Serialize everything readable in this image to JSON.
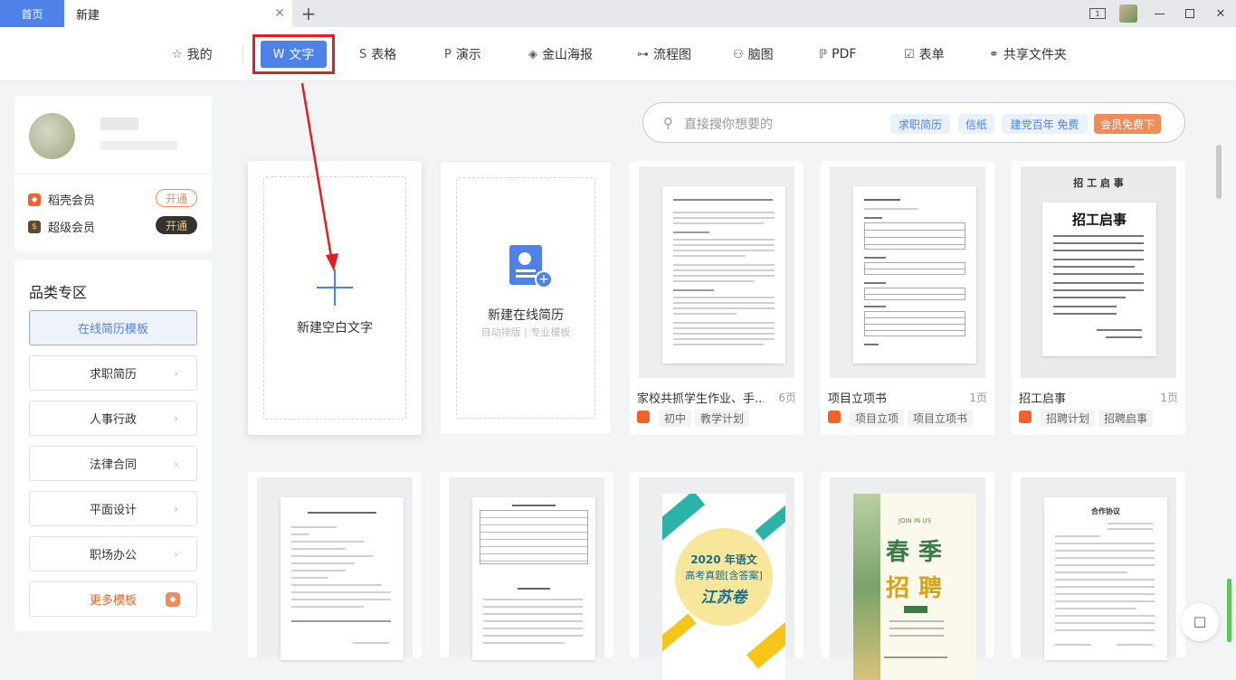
{
  "tabs": {
    "home": "首页",
    "current": "新建",
    "close": "✕",
    "add": "+"
  },
  "nav": {
    "items": [
      "我的",
      "文字",
      "表格",
      "演示",
      "金山海报",
      "流程图",
      "脑图",
      "PDF",
      "表单",
      "共享文件夹"
    ],
    "active": "文字"
  },
  "user": {
    "member1": "稻壳会员",
    "member1_btn": "开通",
    "member2": "超级会员",
    "member2_btn": "开通"
  },
  "categories": {
    "title": "品类专区",
    "items": [
      "在线简历模板",
      "求职简历",
      "人事行政",
      "法律合同",
      "平面设计",
      "职场办公",
      "更多模板"
    ]
  },
  "search": {
    "placeholder": "直接搜你想要的",
    "tags": [
      "求职简历",
      "信纸",
      "建党百年 免费",
      "会员免费下"
    ]
  },
  "create": {
    "blank": "新建空白文字",
    "resume": "新建在线简历",
    "resume_sub": "自动排版 | 专业模板"
  },
  "templates": [
    {
      "title": "家校共抓学生作业、手...",
      "pages": "6页",
      "tags": [
        "初中",
        "教学计划"
      ]
    },
    {
      "title": "项目立项书",
      "pages": "1页",
      "tags": [
        "项目立项",
        "项目立项书"
      ]
    },
    {
      "title": "招工启事",
      "pages": "1页",
      "tags": [
        "招聘计划",
        "招聘启事"
      ],
      "poster_title": "招工启事",
      "poster_header": "招 工 启 事"
    }
  ],
  "row2": {
    "poster_2020": "2020 年语文",
    "poster_exam": "高考真题[含答案]",
    "poster_js": "江苏卷",
    "spring_en": "JOIN IN US",
    "spring_1": "春",
    "spring_2": "季",
    "spring_3": "招",
    "spring_4": "聘",
    "contract": "合作协议"
  },
  "colors": {
    "accent": "#4f82e8",
    "highlight": "#e02020",
    "vip": "#f0622a"
  }
}
